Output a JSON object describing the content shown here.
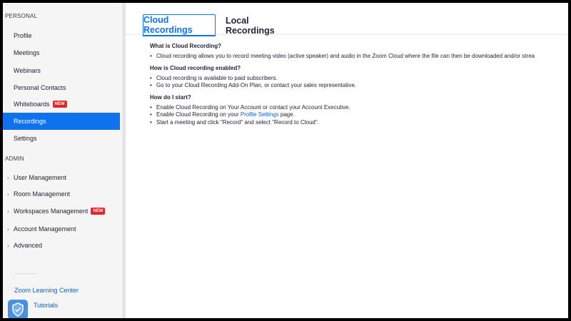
{
  "sidebar": {
    "personal_heading": "PERSONAL",
    "personal_items": [
      {
        "label": "Profile"
      },
      {
        "label": "Meetings"
      },
      {
        "label": "Webinars"
      },
      {
        "label": "Personal Contacts"
      },
      {
        "label": "Whiteboards",
        "badge": "NEW"
      },
      {
        "label": "Recordings",
        "active": true
      },
      {
        "label": "Settings"
      }
    ],
    "admin_heading": "ADMIN",
    "admin_items": [
      {
        "label": "User Management"
      },
      {
        "label": "Room Management"
      },
      {
        "label": "Workspaces Management",
        "badge": "NEW"
      },
      {
        "label": "Account Management"
      },
      {
        "label": "Advanced"
      }
    ],
    "links": [
      "Zoom Learning Center",
      "Tutorials"
    ]
  },
  "tabs": [
    {
      "label": "Cloud Recordings",
      "active": true
    },
    {
      "label": "Local Recordings",
      "active": false
    }
  ],
  "content": {
    "q1": "What is Cloud Recording?",
    "q1_bullets": [
      "Cloud recording allows you to record meeting video (active speaker) and audio in the Zoom Cloud where the file can then be downloaded and/or strea"
    ],
    "q2": "How is Cloud recording enabled?",
    "q2_bullets": [
      "Cloud recording is available to paid subscribers.",
      "Go to your Cloud Recording Add-On Plan, or contact your sales representative."
    ],
    "q3": "How do I start?",
    "q3_bullets": {
      "b1": "Enable Cloud Recording on Your Account or contact your Account Executive.",
      "b2_prefix": "Enable Cloud Recording on your ",
      "b2_link": "Profile Settings",
      "b2_suffix": " page.",
      "b3": "Start a meeting and click \"Record\" and select \"Record to Cloud\"."
    }
  },
  "colors": {
    "accent": "#0e72ed",
    "badge": "#e02828"
  }
}
